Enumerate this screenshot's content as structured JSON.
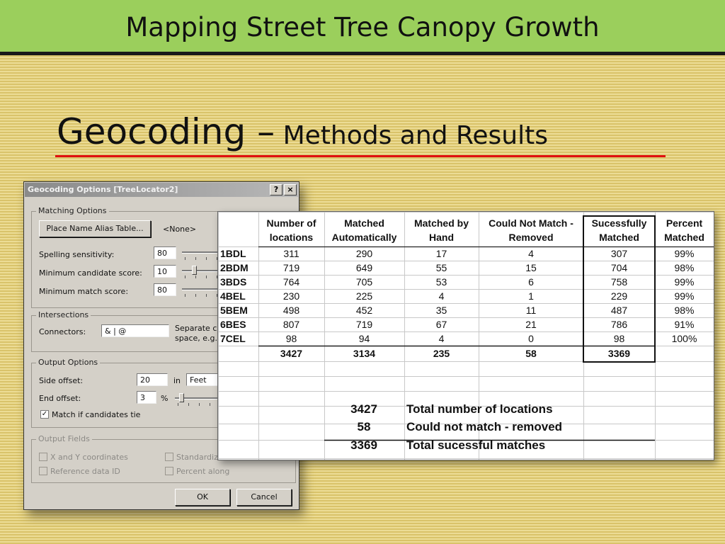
{
  "slide": {
    "title": "Mapping Street Tree Canopy Growth",
    "heading_main": "Geocoding –",
    "heading_sub": " Methods and Results",
    "colors": {
      "header_bar": "#9bcf5c",
      "rule": "#e01010",
      "background": "#e6d484"
    }
  },
  "dialog": {
    "title": "Geocoding Options [TreeLocator2]",
    "help_button": "?",
    "close_button": "×",
    "matching": {
      "group_label": "Matching Options",
      "alias_button": "Place Name Alias Table...",
      "alias_value": "<None>",
      "spelling_label": "Spelling sensitivity:",
      "spelling_value": "80",
      "candidate_label": "Minimum candidate score:",
      "candidate_value": "10",
      "match_label": "Minimum match score:",
      "match_value": "80"
    },
    "intersections": {
      "group_label": "Intersections",
      "connectors_label": "Connectors:",
      "connectors_value": "& | @",
      "separate_text_1": "Separate co",
      "separate_text_2": "space, e.g."
    },
    "output": {
      "group_label": "Output Options",
      "side_offset_label": "Side offset:",
      "side_offset_value": "20",
      "in_label": "in",
      "unit_value": "Feet",
      "end_offset_label": "End offset:",
      "end_offset_value": "3",
      "percent_label": "%",
      "tie_label": "Match if candidates tie",
      "tie_checked": true
    },
    "fields": {
      "group_label": "Output Fields",
      "xy": "X and Y coordinates",
      "refid": "Reference data ID",
      "standardized": "Standardiz",
      "percent_along": "Percent along"
    },
    "ok": "OK",
    "cancel": "Cancel"
  },
  "table": {
    "headers": [
      [
        "",
        ""
      ],
      [
        "Number of",
        "locations"
      ],
      [
        "Matched",
        "Automatically"
      ],
      [
        "Matched by",
        "Hand"
      ],
      [
        "Could Not Match -",
        "Removed"
      ],
      [
        "Sucessfully",
        "Matched"
      ],
      [
        "Percent",
        "Matched"
      ]
    ],
    "rows": [
      [
        "1BDL",
        "311",
        "290",
        "17",
        "4",
        "307",
        "99%"
      ],
      [
        "2BDM",
        "719",
        "649",
        "55",
        "15",
        "704",
        "98%"
      ],
      [
        "3BDS",
        "764",
        "705",
        "53",
        "6",
        "758",
        "99%"
      ],
      [
        "4BEL",
        "230",
        "225",
        "4",
        "1",
        "229",
        "99%"
      ],
      [
        "5BEM",
        "498",
        "452",
        "35",
        "11",
        "487",
        "98%"
      ],
      [
        "6BES",
        "807",
        "719",
        "67",
        "21",
        "786",
        "91%"
      ],
      [
        "7CEL",
        "98",
        "94",
        "4",
        "0",
        "98",
        "100%"
      ]
    ],
    "totals": [
      "",
      "3427",
      "3134",
      "235",
      "58",
      "3369",
      ""
    ],
    "summary": [
      {
        "value": "3427",
        "label": "Total number of locations"
      },
      {
        "value": "58",
        "label": "Could not match - removed"
      },
      {
        "value": "3369",
        "label": "Total sucessful matches"
      }
    ]
  }
}
